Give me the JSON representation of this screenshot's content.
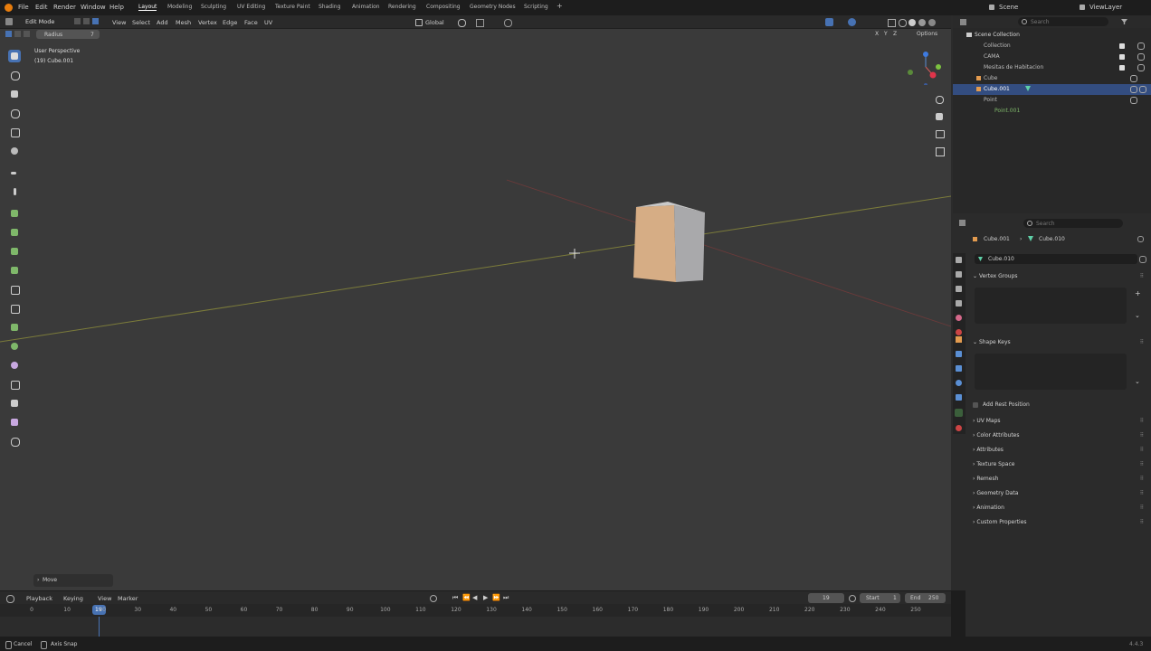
{
  "topbar": {
    "menus": [
      "File",
      "Edit",
      "Render",
      "Window",
      "Help"
    ],
    "workspaces": [
      "Layout",
      "Modeling",
      "Sculpting",
      "UV Editing",
      "Texture Paint",
      "Shading",
      "Animation",
      "Rendering",
      "Compositing",
      "Geometry Nodes",
      "Scripting"
    ],
    "active_workspace": "Layout",
    "add_tab": "+",
    "scene": "Scene",
    "view_layer": "ViewLayer"
  },
  "viewport_header": {
    "mode": "Edit Mode",
    "menus": [
      "View",
      "Select",
      "Add",
      "Mesh",
      "Vertex",
      "Edge",
      "Face",
      "UV"
    ],
    "transform_orientation": "Global",
    "options": "Options",
    "axes": [
      "X",
      "Y",
      "Z"
    ]
  },
  "tool_header": {
    "field_label": "Radius",
    "field_value": "7"
  },
  "viewport": {
    "perspective": "User Perspective",
    "object_info": "(19) Cube.001",
    "last_operator": "Move"
  },
  "outliner": {
    "search_placeholder": "Search",
    "rows": [
      {
        "label": "Scene Collection",
        "selected": false
      },
      {
        "label": "Collection",
        "selected": false
      },
      {
        "label": "CAMA",
        "selected": false
      },
      {
        "label": "Mesitas de Habitacion",
        "selected": false
      },
      {
        "label": "Cube",
        "selected": false
      },
      {
        "label": "Cube.001",
        "selected": true
      },
      {
        "label": "Point",
        "selected": false
      },
      {
        "label": "Point.001",
        "selected": false
      }
    ]
  },
  "properties": {
    "search_placeholder": "Search",
    "breadcrumb_object": "Cube.001",
    "breadcrumb_data": "Cube.010",
    "data_name": "Cube.010",
    "panels": {
      "vertex_groups": "Vertex Groups",
      "shape_keys": "Shape Keys",
      "add_rest_position": "Add Rest Position",
      "collapsed": [
        "UV Maps",
        "Color Attributes",
        "Attributes",
        "Texture Space",
        "Remesh",
        "Geometry Data",
        "Animation",
        "Custom Properties"
      ]
    }
  },
  "timeline": {
    "menus": [
      "Playback",
      "Keying",
      "View",
      "Marker"
    ],
    "current_frame": "19",
    "start_label": "Start",
    "start_value": "1",
    "end_label": "End",
    "end_value": "250",
    "playhead": "19",
    "ticks": [
      "0",
      "10",
      "20",
      "30",
      "40",
      "50",
      "60",
      "70",
      "80",
      "90",
      "100",
      "110",
      "120",
      "130",
      "140",
      "150",
      "160",
      "170",
      "180",
      "190",
      "200",
      "210",
      "220",
      "230",
      "240",
      "250"
    ]
  },
  "statusbar": {
    "cancel": "Cancel",
    "axis_snap": "Axis Snap",
    "version": "4.4.3"
  },
  "colors": {
    "accent": "#4772b3",
    "cube_front": "#d6ad85",
    "cube_side": "#a9a9ab",
    "x_axis": "#8a3a3a",
    "y_axis": "#8a8a32"
  }
}
